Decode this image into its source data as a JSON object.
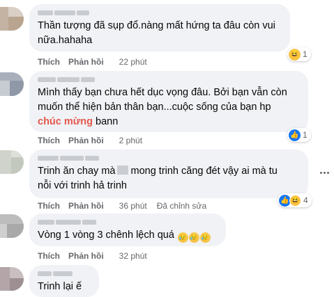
{
  "comments": [
    {
      "lines": [
        "Thần tượng đã sụp đổ.nàng mất hứng ta đâu còn vui",
        "nữa.hahaha"
      ],
      "actions": {
        "like": "Thích",
        "reply": "Phản hồi",
        "time": "22 phút"
      },
      "reaction": {
        "types": [
          "haha-icon"
        ],
        "count": "1"
      }
    },
    {
      "lines": [
        "Mình thấy bạn chưa hết dục vọng đâu. Bởi bạn vẫn còn",
        "muốn thể hiện bản thân bạn...cuộc sống của bạn hp"
      ],
      "highlight": "chúc mừng",
      "tail": " bann",
      "actions": {
        "like": "Thích",
        "reply": "Phản hồi",
        "time": "2 phút"
      },
      "reaction": {
        "types": [
          "like-icon"
        ],
        "count": "1"
      }
    },
    {
      "line1_a": "Trinh ăn chay mà",
      "line1_b": "mong trinh căng đét vậy ai mà tu",
      "line2": "nỗi với trinh hả trinh",
      "actions": {
        "like": "Thích",
        "reply": "Phản hồi",
        "time": "36 phút",
        "edited": "Đã chỉnh sửa"
      },
      "reaction": {
        "types": [
          "like-icon",
          "haha-icon"
        ],
        "count": "4"
      }
    },
    {
      "text": "Vòng 1 vòng 3 chênh lệch quá",
      "emojis": [
        "😥",
        "😥",
        "😥"
      ],
      "actions": {
        "like": "Thích",
        "reply": "Phản hồi",
        "time": "32 phút"
      }
    },
    {
      "text": "Trinh lại ế"
    }
  ],
  "colors": {
    "bubble": "#f0f2f5",
    "meta": "#65676b",
    "highlight": "#e4574d",
    "like": "#1877f2"
  }
}
